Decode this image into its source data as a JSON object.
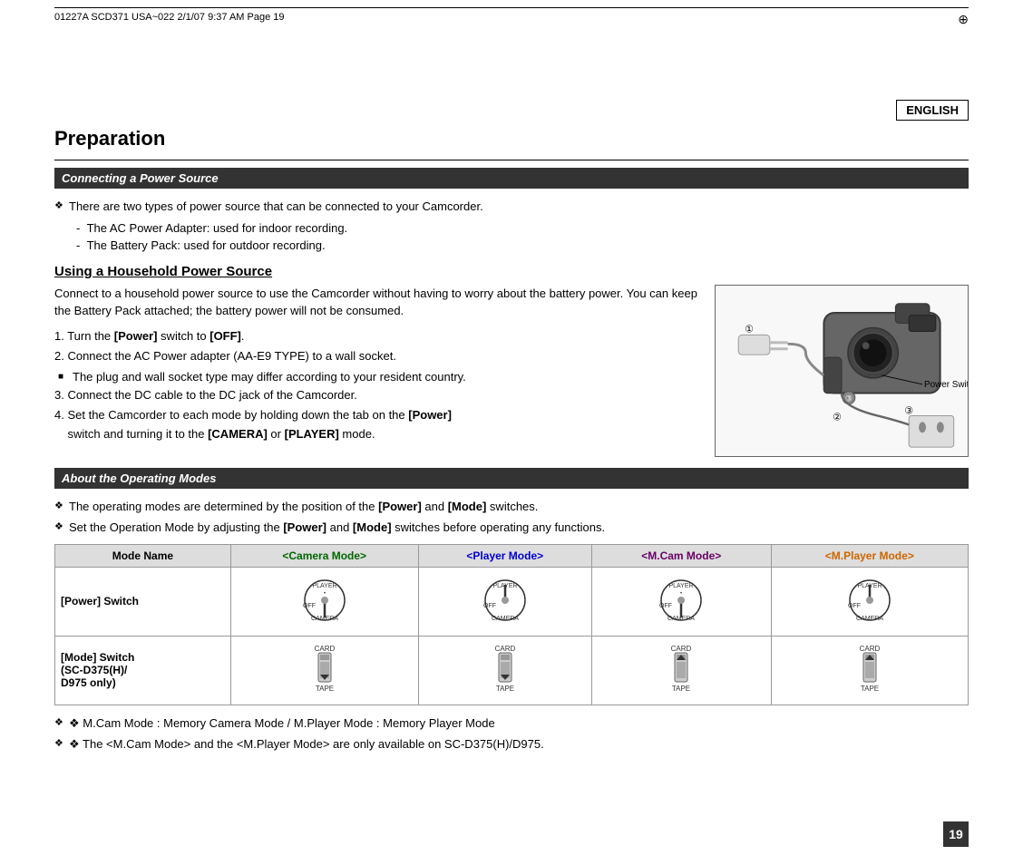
{
  "header": {
    "meta": "01227A SCD371 USA~022  2/1/07 9:37 AM  Page 19",
    "english_label": "ENGLISH"
  },
  "page_title": "Preparation",
  "section1": {
    "bar_title": "Connecting a Power Source",
    "bullet1": "There are two types of power source that can be connected to your Camcorder.",
    "sub1": "The AC Power Adapter: used for indoor recording.",
    "sub2": "The Battery Pack: used for outdoor recording."
  },
  "subsection": {
    "title": "Using a Household Power Source",
    "intro": "Connect to a household power source to use the Camcorder without having to worry about the battery power. You can keep the Battery Pack attached; the battery power will not be consumed.",
    "steps": [
      "1. Turn the [Power] switch to [OFF].",
      "2. Connect the AC Power adapter (AA-E9 TYPE) to a wall socket.",
      "3. Connect the DC cable to the DC jack of the Camcorder.",
      "4. Set the Camcorder to each mode by holding down the tab on the [Power] switch and turning it to the [CAMERA] or [PLAYER] mode."
    ],
    "note": "The plug and wall socket type may differ according to your resident country.",
    "power_switch_label": "Power Switch"
  },
  "section2": {
    "bar_title": "About the Operating Modes",
    "bullet1": "The operating modes are determined by the position of the [Power] and [Mode] switches.",
    "bullet2": "Set the Operation Mode by adjusting the [Power] and [Mode] switches before operating any functions.",
    "table": {
      "headers": [
        "Mode Name",
        "<Camera Mode>",
        "<Player Mode>",
        "<M.Cam Mode>",
        "<M.Player Mode>"
      ],
      "row1_header": "[Power] Switch",
      "row2_header": "[Mode] Switch\n(SC-D375(H)/\nD975 only)"
    },
    "footer1": "❖ M.Cam Mode : Memory Camera Mode / M.Player Mode : Memory Player Mode",
    "footer2": "❖ The <M.Cam Mode> and the <M.Player Mode> are only available on SC-D375(H)/D975."
  },
  "page_number": "19"
}
